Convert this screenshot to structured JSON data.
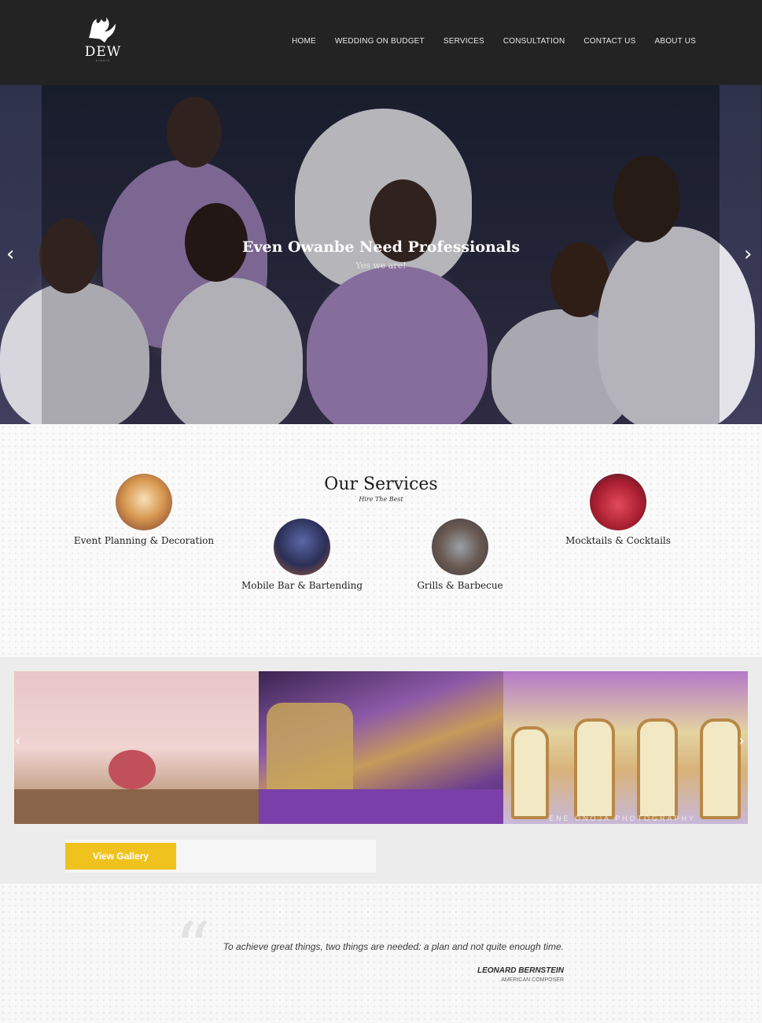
{
  "header": {
    "logo_text": "DEW",
    "logo_sub": "EVENTS",
    "nav": [
      "HOME",
      "WEDDING ON BUDGET",
      "SERVICES",
      "CONSULTATION",
      "CONTACT US",
      "ABOUT US"
    ]
  },
  "hero": {
    "title": "Even Owanbe Need Professionals",
    "subtitle": "Yes we are!",
    "prev_icon": "chevron-left-icon",
    "next_icon": "chevron-right-icon"
  },
  "services": {
    "title": "Our Services",
    "subtitle": "Hire The Best",
    "items": [
      {
        "label": "Event Planning & Decoration",
        "color": "#c98a4a"
      },
      {
        "label": "Mobile Bar & Bartending",
        "color": "#3a3f6a"
      },
      {
        "label": "Grills & Barbecue",
        "color": "#6a6e78"
      },
      {
        "label": "Mocktails & Cocktails",
        "color": "#b3283a"
      }
    ]
  },
  "gallery": {
    "watermark": "ENE ONOJA PHOTOGRAPHY",
    "button": "View Gallery",
    "accent": "#f0c21d"
  },
  "quote": {
    "text": "To achieve great things, two things are needed: a plan and not quite enough time.",
    "author": "LEONARD BERNSTEIN",
    "role": "AMERICAN COMPOSER"
  }
}
